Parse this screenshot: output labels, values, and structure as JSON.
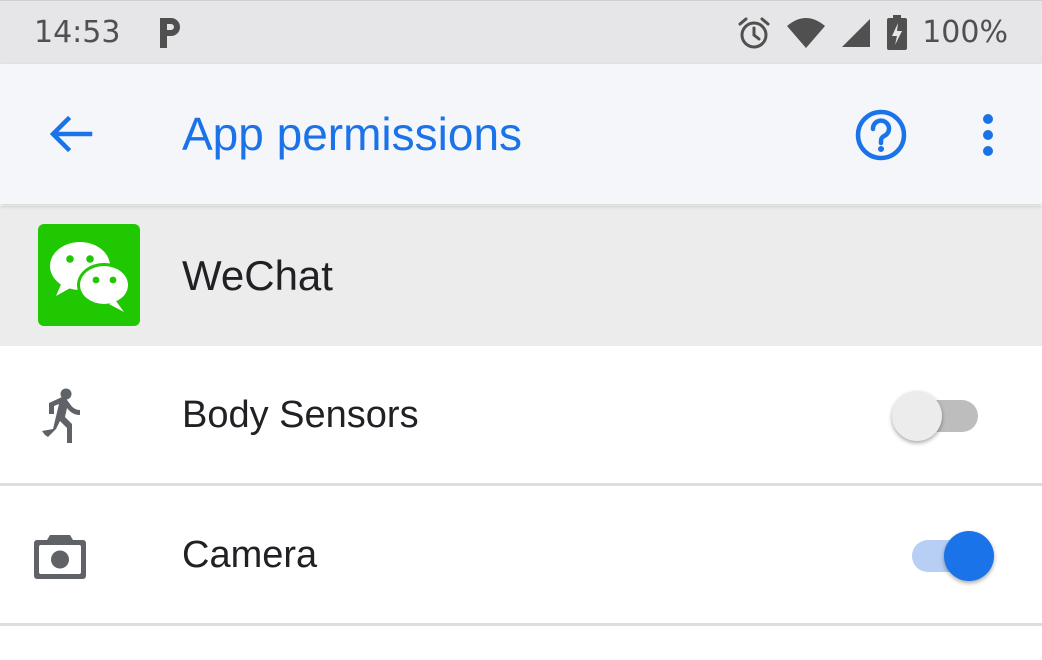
{
  "status_bar": {
    "time": "14:53",
    "battery_percent": "100%",
    "icons": [
      "parking-icon",
      "alarm-icon",
      "wifi-icon",
      "cell-signal-icon",
      "battery-charging-icon"
    ]
  },
  "app_bar": {
    "title": "App permissions",
    "icons": [
      "back-arrow-icon",
      "help-icon",
      "more-vert-icon"
    ]
  },
  "app": {
    "name": "WeChat",
    "icon": "wechat-logo",
    "brand_color": "#1fc800"
  },
  "permissions": [
    {
      "label": "Body Sensors",
      "icon": "directions-run-icon",
      "enabled": false
    },
    {
      "label": "Camera",
      "icon": "camera-icon",
      "enabled": true
    }
  ],
  "colors": {
    "accent": "#1a73e8",
    "status_bar_bg": "#e6e6e8",
    "app_bar_bg": "#f5f6f9",
    "app_row_bg": "#ececec"
  }
}
